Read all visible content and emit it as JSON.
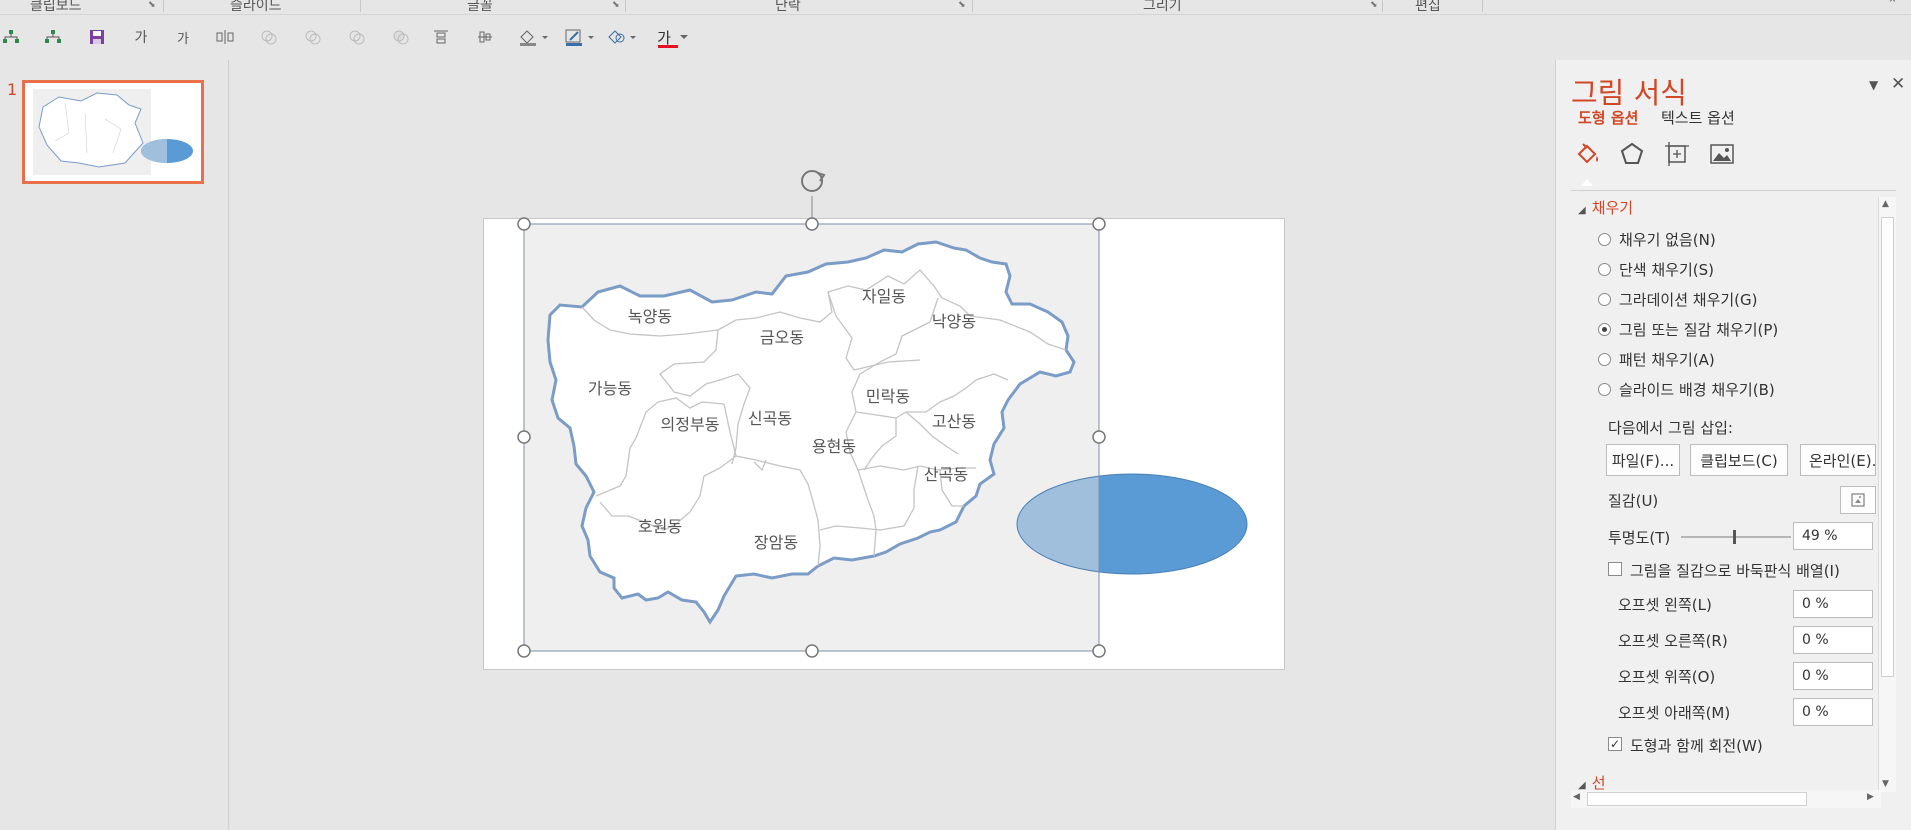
{
  "ribbon": {
    "groups": [
      "클립보드",
      "슬라이드",
      "글꼴",
      "단락",
      "그리기",
      "편집"
    ]
  },
  "qat": {
    "text_a_label": "가",
    "text_b_label": "가",
    "font_color_label": "가",
    "font_color": "#e81123"
  },
  "thumbnail": {
    "number": "1"
  },
  "map": {
    "districts": [
      "녹양동",
      "자일동",
      "낙양동",
      "금오동",
      "가능동",
      "민락동",
      "의정부동",
      "신곡동",
      "고산동",
      "용현동",
      "산곡동",
      "호원동",
      "장암동"
    ]
  },
  "panel": {
    "title": "그림 서식",
    "tab_shape": "도형 옵션",
    "tab_text": "텍스트 옵션",
    "section_fill": "채우기",
    "fill_options": [
      {
        "label": "채우기 없음(N)",
        "selected": false
      },
      {
        "label": "단색 채우기(S)",
        "selected": false
      },
      {
        "label": "그라데이션 채우기(G)",
        "selected": false
      },
      {
        "label": "그림 또는 질감 채우기(P)",
        "selected": true
      },
      {
        "label": "패턴 채우기(A)",
        "selected": false
      },
      {
        "label": "슬라이드 배경 채우기(B)",
        "selected": false
      }
    ],
    "insert_from": "다음에서 그림 삽입:",
    "btn_file": "파일(F)...",
    "btn_clipboard": "클립보드(C)",
    "btn_online": "온라인(E)...",
    "texture_label": "질감(U)",
    "transparency_label": "투명도(T)",
    "transparency_value": "49 %",
    "transparency_fraction": 0.49,
    "tile_label": "그림을 질감으로 바둑판식 배열(I)",
    "tile_checked": false,
    "offsets": [
      {
        "label": "오프셋 왼쪽(L)",
        "value": "0 %"
      },
      {
        "label": "오프셋 오른쪽(R)",
        "value": "0 %"
      },
      {
        "label": "오프셋 위쪽(O)",
        "value": "0 %"
      },
      {
        "label": "오프셋 아래쪽(M)",
        "value": "0 %"
      }
    ],
    "rotate_label": "도형과 함께 회전(W)",
    "rotate_checked": true,
    "section_line": "선"
  },
  "colors": {
    "accent": "#d24726",
    "ellipse_fill": "#5b9bd5",
    "map_border": "#7a9cc6"
  }
}
